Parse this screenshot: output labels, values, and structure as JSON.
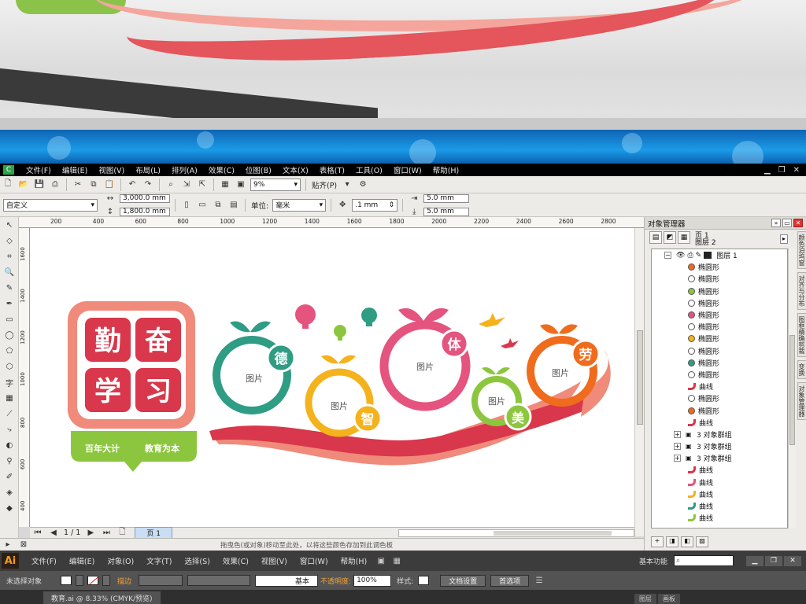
{
  "colors": {
    "red": "#d9374b",
    "salmon": "#f08a7a",
    "green": "#8cc63f",
    "teal": "#2f9c84",
    "yellow": "#f4b21d",
    "pink": "#e5537f",
    "orange": "#ef6c1d",
    "lime": "#8cc63f"
  },
  "corel": {
    "menu": [
      "文件(F)",
      "编辑(E)",
      "视图(V)",
      "布局(L)",
      "排列(A)",
      "效果(C)",
      "位图(B)",
      "文本(X)",
      "表格(T)",
      "工具(O)",
      "窗口(W)",
      "帮助(H)"
    ],
    "zoom": "9%",
    "snap_label": "贴齐(P)",
    "preset": "自定义",
    "width": "3,000.0 mm",
    "height": "1,800.0 mm",
    "units_label": "单位:",
    "units_value": "毫米",
    "nudge": ".1 mm",
    "dup_x": "5.0 mm",
    "dup_y": "5.0 mm",
    "ruler_h": [
      "200",
      "400",
      "600",
      "800",
      "1000",
      "1200",
      "1400",
      "1600",
      "1800",
      "2000",
      "2200",
      "2400",
      "2600",
      "2800"
    ],
    "ruler_v": [
      "1600",
      "1400",
      "1200",
      "1000",
      "800",
      "600",
      "400"
    ],
    "page_count": "1 / 1",
    "page_tab": "页 1",
    "status": "拖曳色(或对象)移动至此处，以将这些颜色存加到此调色板",
    "docker_title": "对象管理器",
    "pages_tree": [
      "页 1",
      "图层 2"
    ],
    "layer1": "图层 1",
    "objects": [
      {
        "kind": "ellipse",
        "label": "椭圆形",
        "color": "#ef6c1d"
      },
      {
        "kind": "ellipse",
        "label": "椭圆形",
        "color": "#ffffff"
      },
      {
        "kind": "ellipse",
        "label": "椭圆形",
        "color": "#8cc63f"
      },
      {
        "kind": "ellipse",
        "label": "椭圆形",
        "color": "#ffffff"
      },
      {
        "kind": "ellipse",
        "label": "椭圆形",
        "color": "#e5537f"
      },
      {
        "kind": "ellipse",
        "label": "椭圆形",
        "color": "#ffffff"
      },
      {
        "kind": "ellipse",
        "label": "椭圆形",
        "color": "#f4b21d"
      },
      {
        "kind": "ellipse",
        "label": "椭圆形",
        "color": "#ffffff"
      },
      {
        "kind": "ellipse",
        "label": "椭圆形",
        "color": "#2f9c84"
      },
      {
        "kind": "ellipse",
        "label": "椭圆形",
        "color": "#ffffff"
      },
      {
        "kind": "curve",
        "label": "曲线",
        "color": "#d9374b"
      },
      {
        "kind": "ellipse",
        "label": "椭圆形",
        "color": "#ffffff"
      },
      {
        "kind": "ellipse",
        "label": "椭圆形",
        "color": "#ef6c1d"
      },
      {
        "kind": "curve",
        "label": "曲线",
        "color": "#d9374b"
      },
      {
        "kind": "group",
        "label": "3 对象群组",
        "color": ""
      },
      {
        "kind": "group",
        "label": "3 对象群组",
        "color": ""
      },
      {
        "kind": "group",
        "label": "3 对象群组",
        "color": ""
      },
      {
        "kind": "curve",
        "label": "曲线",
        "color": "#d9374b"
      },
      {
        "kind": "curve",
        "label": "曲线",
        "color": "#e5537f"
      },
      {
        "kind": "curve",
        "label": "曲线",
        "color": "#f4b21d"
      },
      {
        "kind": "curve",
        "label": "曲线",
        "color": "#2f9c84"
      },
      {
        "kind": "curve",
        "label": "曲线",
        "color": "#8cc63f"
      }
    ],
    "side_tabs": [
      "颜色泊坞窗",
      "对齐与分布",
      "图框精确剪裁",
      "变换",
      "对象管理器"
    ]
  },
  "design": {
    "tiles": [
      "勤",
      "奋",
      "学",
      "习"
    ],
    "slogan_left": "百年大计",
    "slogan_right": "教育为本",
    "rings": [
      {
        "char": "德",
        "placeholder": "图片"
      },
      {
        "char": "智",
        "placeholder": "图片"
      },
      {
        "char": "体",
        "placeholder": "图片"
      },
      {
        "char": "美",
        "placeholder": "图片"
      },
      {
        "char": "劳",
        "placeholder": "图片"
      }
    ]
  },
  "ai": {
    "menu": [
      "文件(F)",
      "编辑(E)",
      "对象(O)",
      "文字(T)",
      "选择(S)",
      "效果(C)",
      "视图(V)",
      "窗口(W)",
      "帮助(H)"
    ],
    "workspace": "基本功能",
    "selection": "未选择对象",
    "stroke_label": "描边",
    "brush": "基本",
    "opacity_label": "不透明度:",
    "opacity": "100%",
    "style_label": "样式:",
    "doc_setup": "文档设置",
    "prefs": "首选项",
    "doc_tab": "教育.ai @ 8.33% (CMYK/预览)",
    "panel_tabs": [
      "图层",
      "画板"
    ]
  }
}
